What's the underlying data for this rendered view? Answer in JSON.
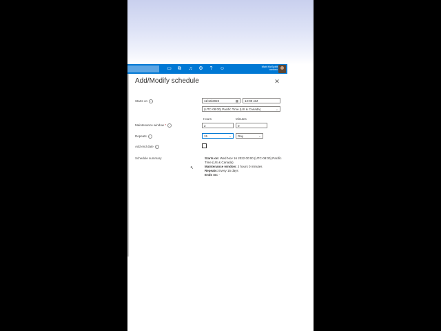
{
  "header": {
    "user_name": "Matt McSpirit",
    "tenant": "contoso",
    "icons": [
      "terminal-icon",
      "directory-icon",
      "bell-icon",
      "gear-icon",
      "help-icon",
      "feedback-icon"
    ]
  },
  "dialog": {
    "title": "Add/Modify schedule",
    "close_glyph": "✕"
  },
  "form": {
    "starts_on": {
      "label": "Starts on",
      "date_value": "11/16/2022",
      "time_value": "12:00 AM",
      "timezone_value": "(UTC-08:00) Pacific Time (US & Canada)"
    },
    "maintenance_window": {
      "label": "Maintenance window",
      "required_mark": "*",
      "hours_header": "Hours",
      "minutes_header": "Minutes",
      "hours_value": "2",
      "minutes_value": "0"
    },
    "repeats": {
      "label": "Repeats",
      "count_value": "15",
      "unit_value": "Day"
    },
    "end_date": {
      "label": "Add end date",
      "checked": false
    },
    "summary": {
      "label": "Schedule summary",
      "starts_on_key": "Starts on:",
      "starts_on_value": "Wed Nov 16 2022 00:00 (UTC-08:00) Pacific Time (US & Canada)",
      "maintenance_key": "Maintenance window:",
      "maintenance_value": "2 hours 0 minutes",
      "repeats_key": "Repeats:",
      "repeats_value": "Every 15 days",
      "ends_key": "Ends on:",
      "ends_value": "-"
    }
  },
  "colors": {
    "topbar": "#0078d4",
    "focus": "#0078d4"
  }
}
